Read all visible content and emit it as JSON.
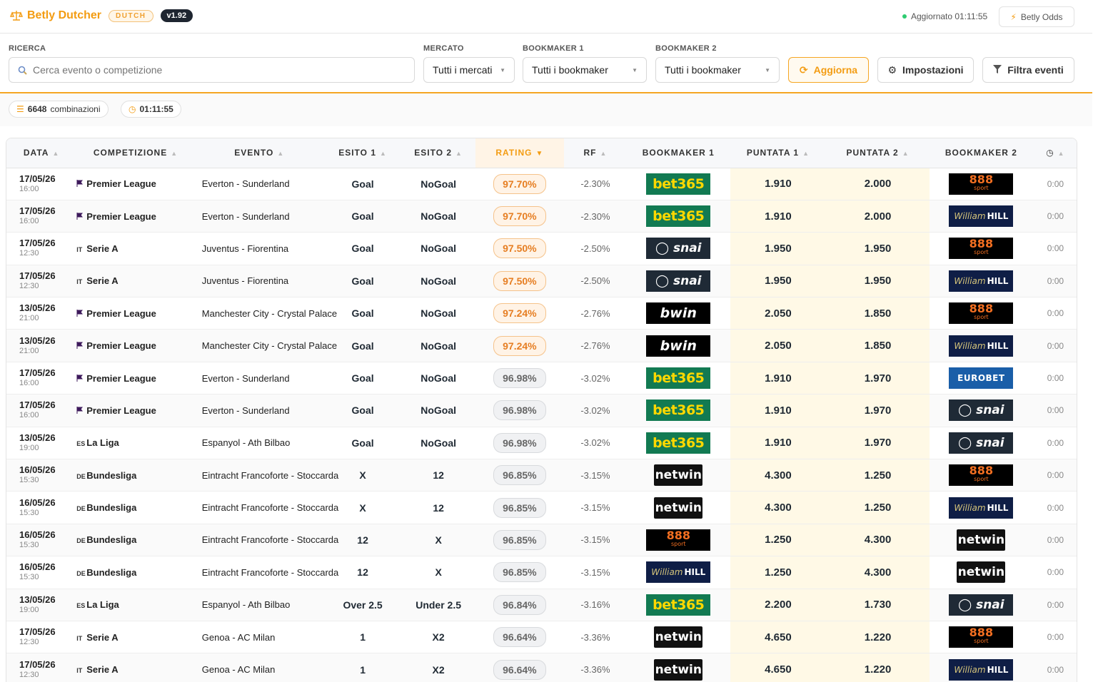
{
  "header": {
    "app_title": "Betly Dutcher",
    "badge": "DUTCH",
    "version": "v1.92",
    "status": "Aggiornato 01:11:55",
    "odds_button": "Betly Odds"
  },
  "filters": {
    "search_label": "RICERCA",
    "search_placeholder": "Cerca evento o competizione",
    "market_label": "MERCATO",
    "market_value": "Tutti i mercati",
    "bookmaker1_label": "BOOKMAKER 1",
    "bookmaker1_value": "Tutti i bookmaker",
    "bookmaker2_label": "BOOKMAKER 2",
    "bookmaker2_value": "Tutti i bookmaker",
    "refresh_button": "Aggiorna",
    "settings_button": "Impostazioni",
    "filter_button": "Filtra eventi"
  },
  "info": {
    "combinations_count": "6648",
    "combinations_label": "combinazioni",
    "timer": "01:11:55"
  },
  "table": {
    "columns": [
      "DATA",
      "COMPETIZIONE",
      "EVENTO",
      "ESITO 1",
      "ESITO 2",
      "RATING",
      "RF",
      "BOOKMAKER 1",
      "PUNTATA 1",
      "PUNTATA 2",
      "BOOKMAKER 2"
    ],
    "rows": [
      {
        "date": "17/05/26",
        "time": "16:00",
        "flag": "pl",
        "comp": "Premier League",
        "event": "Everton - Sunderland",
        "e1": "Goal",
        "e2": "NoGoal",
        "rating": "97.70%",
        "hi": true,
        "rf": "-2.30%",
        "bk1": "bet365",
        "p1": "1.910",
        "p2": "2.000",
        "bk2": "888",
        "age": "0:00"
      },
      {
        "date": "17/05/26",
        "time": "16:00",
        "flag": "pl",
        "comp": "Premier League",
        "event": "Everton - Sunderland",
        "e1": "Goal",
        "e2": "NoGoal",
        "rating": "97.70%",
        "hi": true,
        "rf": "-2.30%",
        "bk1": "bet365",
        "p1": "1.910",
        "p2": "2.000",
        "bk2": "williamhill",
        "age": "0:00"
      },
      {
        "date": "17/05/26",
        "time": "12:30",
        "flag": "IT",
        "comp": "Serie A",
        "event": "Juventus - Fiorentina",
        "e1": "Goal",
        "e2": "NoGoal",
        "rating": "97.50%",
        "hi": true,
        "rf": "-2.50%",
        "bk1": "snai",
        "p1": "1.950",
        "p2": "1.950",
        "bk2": "888",
        "age": "0:00"
      },
      {
        "date": "17/05/26",
        "time": "12:30",
        "flag": "IT",
        "comp": "Serie A",
        "event": "Juventus - Fiorentina",
        "e1": "Goal",
        "e2": "NoGoal",
        "rating": "97.50%",
        "hi": true,
        "rf": "-2.50%",
        "bk1": "snai",
        "p1": "1.950",
        "p2": "1.950",
        "bk2": "williamhill",
        "age": "0:00"
      },
      {
        "date": "13/05/26",
        "time": "21:00",
        "flag": "pl",
        "comp": "Premier League",
        "event": "Manchester City - Crystal Palace",
        "e1": "Goal",
        "e2": "NoGoal",
        "rating": "97.24%",
        "hi": true,
        "rf": "-2.76%",
        "bk1": "bwin",
        "p1": "2.050",
        "p2": "1.850",
        "bk2": "888",
        "age": "0:00"
      },
      {
        "date": "13/05/26",
        "time": "21:00",
        "flag": "pl",
        "comp": "Premier League",
        "event": "Manchester City - Crystal Palace",
        "e1": "Goal",
        "e2": "NoGoal",
        "rating": "97.24%",
        "hi": true,
        "rf": "-2.76%",
        "bk1": "bwin",
        "p1": "2.050",
        "p2": "1.850",
        "bk2": "williamhill",
        "age": "0:00"
      },
      {
        "date": "17/05/26",
        "time": "16:00",
        "flag": "pl",
        "comp": "Premier League",
        "event": "Everton - Sunderland",
        "e1": "Goal",
        "e2": "NoGoal",
        "rating": "96.98%",
        "hi": false,
        "rf": "-3.02%",
        "bk1": "bet365",
        "p1": "1.910",
        "p2": "1.970",
        "bk2": "eurobet",
        "age": "0:00"
      },
      {
        "date": "17/05/26",
        "time": "16:00",
        "flag": "pl",
        "comp": "Premier League",
        "event": "Everton - Sunderland",
        "e1": "Goal",
        "e2": "NoGoal",
        "rating": "96.98%",
        "hi": false,
        "rf": "-3.02%",
        "bk1": "bet365",
        "p1": "1.910",
        "p2": "1.970",
        "bk2": "snai",
        "age": "0:00"
      },
      {
        "date": "13/05/26",
        "time": "19:00",
        "flag": "ES",
        "comp": "La Liga",
        "event": "Espanyol - Ath Bilbao",
        "e1": "Goal",
        "e2": "NoGoal",
        "rating": "96.98%",
        "hi": false,
        "rf": "-3.02%",
        "bk1": "bet365",
        "p1": "1.910",
        "p2": "1.970",
        "bk2": "snai",
        "age": "0:00"
      },
      {
        "date": "16/05/26",
        "time": "15:30",
        "flag": "DE",
        "comp": "Bundesliga",
        "event": "Eintracht Francoforte - Stoccarda",
        "e1": "X",
        "e2": "12",
        "rating": "96.85%",
        "hi": false,
        "rf": "-3.15%",
        "bk1": "netwin",
        "p1": "4.300",
        "p2": "1.250",
        "bk2": "888",
        "age": "0:00"
      },
      {
        "date": "16/05/26",
        "time": "15:30",
        "flag": "DE",
        "comp": "Bundesliga",
        "event": "Eintracht Francoforte - Stoccarda",
        "e1": "X",
        "e2": "12",
        "rating": "96.85%",
        "hi": false,
        "rf": "-3.15%",
        "bk1": "netwin",
        "p1": "4.300",
        "p2": "1.250",
        "bk2": "williamhill",
        "age": "0:00"
      },
      {
        "date": "16/05/26",
        "time": "15:30",
        "flag": "DE",
        "comp": "Bundesliga",
        "event": "Eintracht Francoforte - Stoccarda",
        "e1": "12",
        "e2": "X",
        "rating": "96.85%",
        "hi": false,
        "rf": "-3.15%",
        "bk1": "888",
        "p1": "1.250",
        "p2": "4.300",
        "bk2": "netwin",
        "age": "0:00"
      },
      {
        "date": "16/05/26",
        "time": "15:30",
        "flag": "DE",
        "comp": "Bundesliga",
        "event": "Eintracht Francoforte - Stoccarda",
        "e1": "12",
        "e2": "X",
        "rating": "96.85%",
        "hi": false,
        "rf": "-3.15%",
        "bk1": "williamhill",
        "p1": "1.250",
        "p2": "4.300",
        "bk2": "netwin",
        "age": "0:00"
      },
      {
        "date": "13/05/26",
        "time": "19:00",
        "flag": "ES",
        "comp": "La Liga",
        "event": "Espanyol - Ath Bilbao",
        "e1": "Over 2.5",
        "e2": "Under 2.5",
        "rating": "96.84%",
        "hi": false,
        "rf": "-3.16%",
        "bk1": "bet365",
        "p1": "2.200",
        "p2": "1.730",
        "bk2": "snai",
        "age": "0:00"
      },
      {
        "date": "17/05/26",
        "time": "12:30",
        "flag": "IT",
        "comp": "Serie A",
        "event": "Genoa - AC Milan",
        "e1": "1",
        "e2": "X2",
        "rating": "96.64%",
        "hi": false,
        "rf": "-3.36%",
        "bk1": "netwin",
        "p1": "4.650",
        "p2": "1.220",
        "bk2": "888",
        "age": "0:00"
      },
      {
        "date": "17/05/26",
        "time": "12:30",
        "flag": "IT",
        "comp": "Serie A",
        "event": "Genoa - AC Milan",
        "e1": "1",
        "e2": "X2",
        "rating": "96.64%",
        "hi": false,
        "rf": "-3.36%",
        "bk1": "netwin",
        "p1": "4.650",
        "p2": "1.220",
        "bk2": "williamhill",
        "age": "0:00"
      }
    ]
  },
  "logos": {
    "bet365": "bet365",
    "snai": "snai",
    "bwin": "bwin",
    "888": "888",
    "888_sub": "sport",
    "williamhill_a": "William",
    "williamhill_b": "HILL",
    "eurobet": "EUROBET",
    "netwin": "netwin"
  },
  "colors": {
    "accent": "#f39c12",
    "status_online": "#2ecc71"
  }
}
